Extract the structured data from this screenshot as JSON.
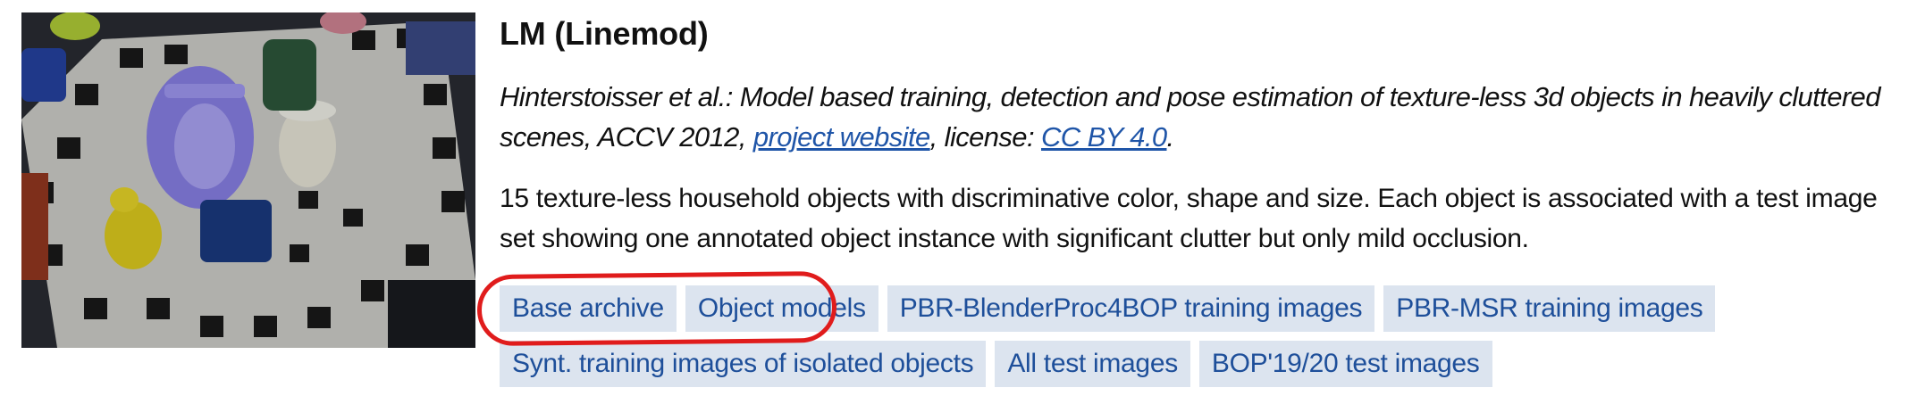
{
  "dataset": {
    "title": "LM (Linemod)",
    "citation_text": "Hinterstoisser et al.: Model based training, detection and pose estimation of texture-less 3d objects in heavily cluttered scenes, ACCV 2012,",
    "project_link": "project website",
    "license_prefix": ", license: ",
    "license_link": "CC BY 4.0",
    "license_suffix": ".",
    "description": "15 texture-less household objects with discriminative color, shape and size. Each object is associated with a test image set showing one annotated object instance with significant clutter but only mild occlusion."
  },
  "downloads": {
    "row1": [
      "Base archive",
      "Object models",
      "PBR-BlenderProc4BOP training images",
      "PBR-MSR training images"
    ],
    "row2": [
      "Synt. training images of isolated objects",
      "All test images",
      "BOP'19/20 test images"
    ]
  },
  "colors": {
    "link": "#1f55a8",
    "chip_bg": "#dce4ef",
    "chip_text": "#1e4f9a",
    "annotation": "#e01c1c"
  }
}
